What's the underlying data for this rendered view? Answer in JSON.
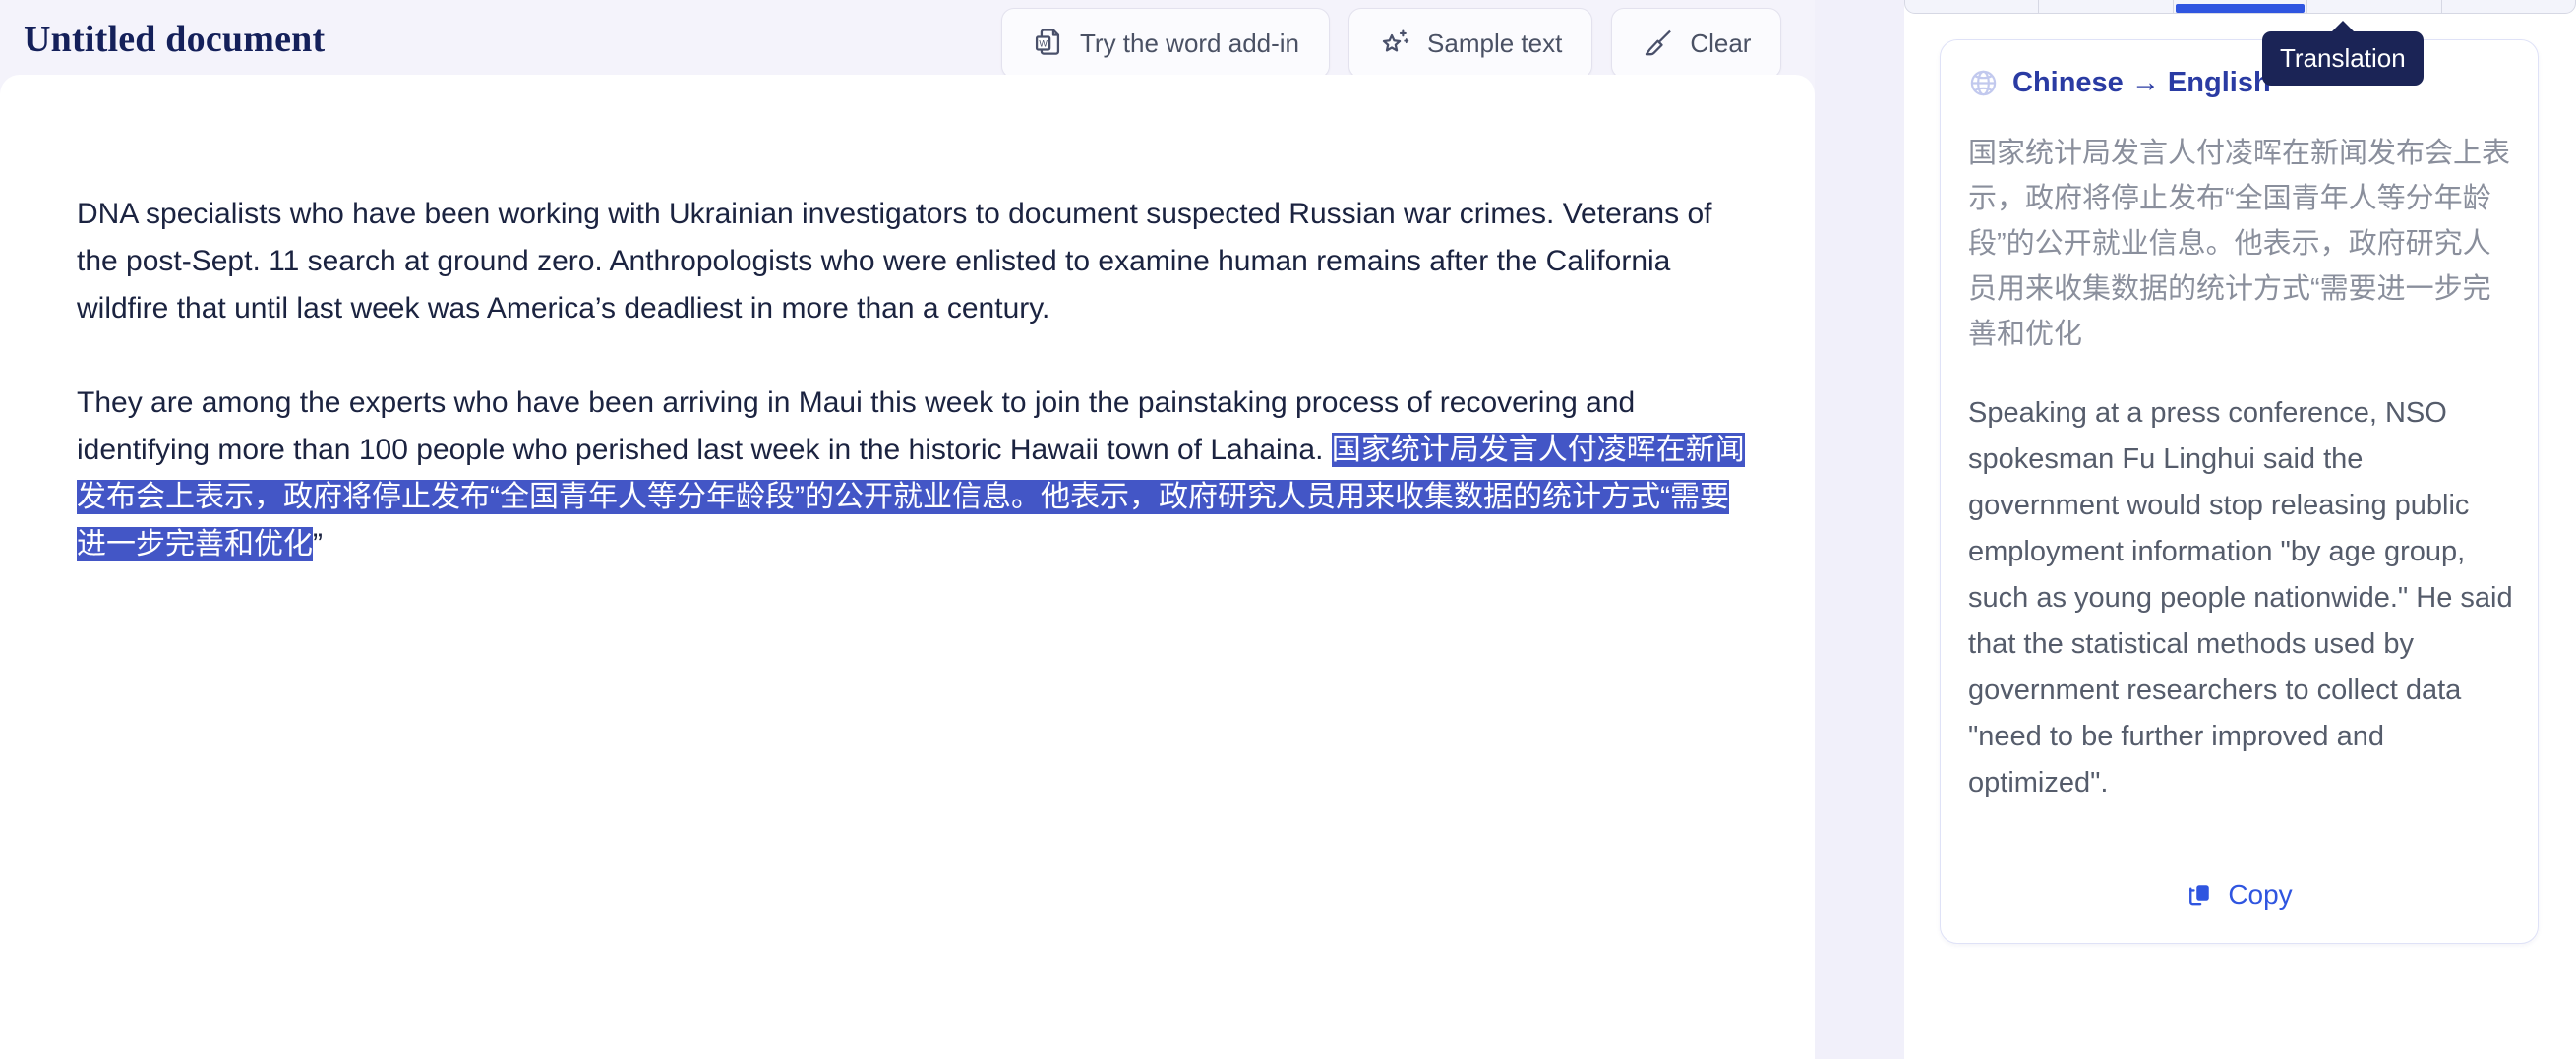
{
  "editor": {
    "title": "Untitled document",
    "actions": [
      {
        "label": "Try the word add-in",
        "icon": "word-document-icon"
      },
      {
        "label": "Sample text",
        "icon": "sparkle-star-icon"
      },
      {
        "label": "Clear",
        "icon": "broom-icon"
      }
    ],
    "document": {
      "paragraphs": [
        {
          "id": "p1",
          "text": "DNA specialists who have been working with Ukrainian investigators to document suspected Russian war crimes. Veterans of the post-Sept. 11 search at ground zero. Anthropologists who were enlisted to examine human remains after the California wildfire that until last week was America’s deadliest in more than a century.",
          "selected": false
        },
        {
          "id": "p2",
          "lead": "They are among the experts who have been arriving in Maui this week to join the painstaking process of recovering and identifying more than 100 people who perished last week in the historic Hawaii town of Lahaina.",
          "selected_text": "国家统计局发言人付凌晖在新闻发布会上表示，政府将停止发布“全国青年人等分年龄段”的公开就业信息。他表示，政府研究人员用来收集数据的统计方式“需要进一步完善和优化",
          "unselected_tail": "”",
          "selected": true
        }
      ]
    }
  },
  "panel": {
    "tooltip": "Translation",
    "tabs": [
      {
        "label": "",
        "active": false
      },
      {
        "label": "",
        "active": false
      },
      {
        "label": "",
        "active": true
      },
      {
        "label": "",
        "active": false
      },
      {
        "label": "",
        "active": false
      }
    ],
    "card": {
      "title": "Chinese → English",
      "globe_icon": "globe-icon",
      "source_text": "国家统计局发言人付凌晖在新闻发布会上表示，政府将停止发布“全国青年人等分年龄段”的公开就业信息。他表示，政府研究人员用来收集数据的统计方式“需要进一步完善和优化",
      "translated_text": "Speaking at a press conference, NSO spokesman Fu Linghui said the government would stop releasing public employment information \"by age group, such as young people nationwide.\" He said that the statistical methods used by government researchers to collect data \"need to be further improved and optimized\".",
      "copy_label": "Copy",
      "copy_icon": "copy-icon"
    }
  },
  "colors": {
    "accent_blue": "#2f55e0",
    "title_navy": "#14205a",
    "selection_blue": "#4356c6",
    "card_title_blue": "#2a3ba3",
    "tooltip_navy": "#1b2456",
    "editor_bg": "#f4f3fb"
  }
}
